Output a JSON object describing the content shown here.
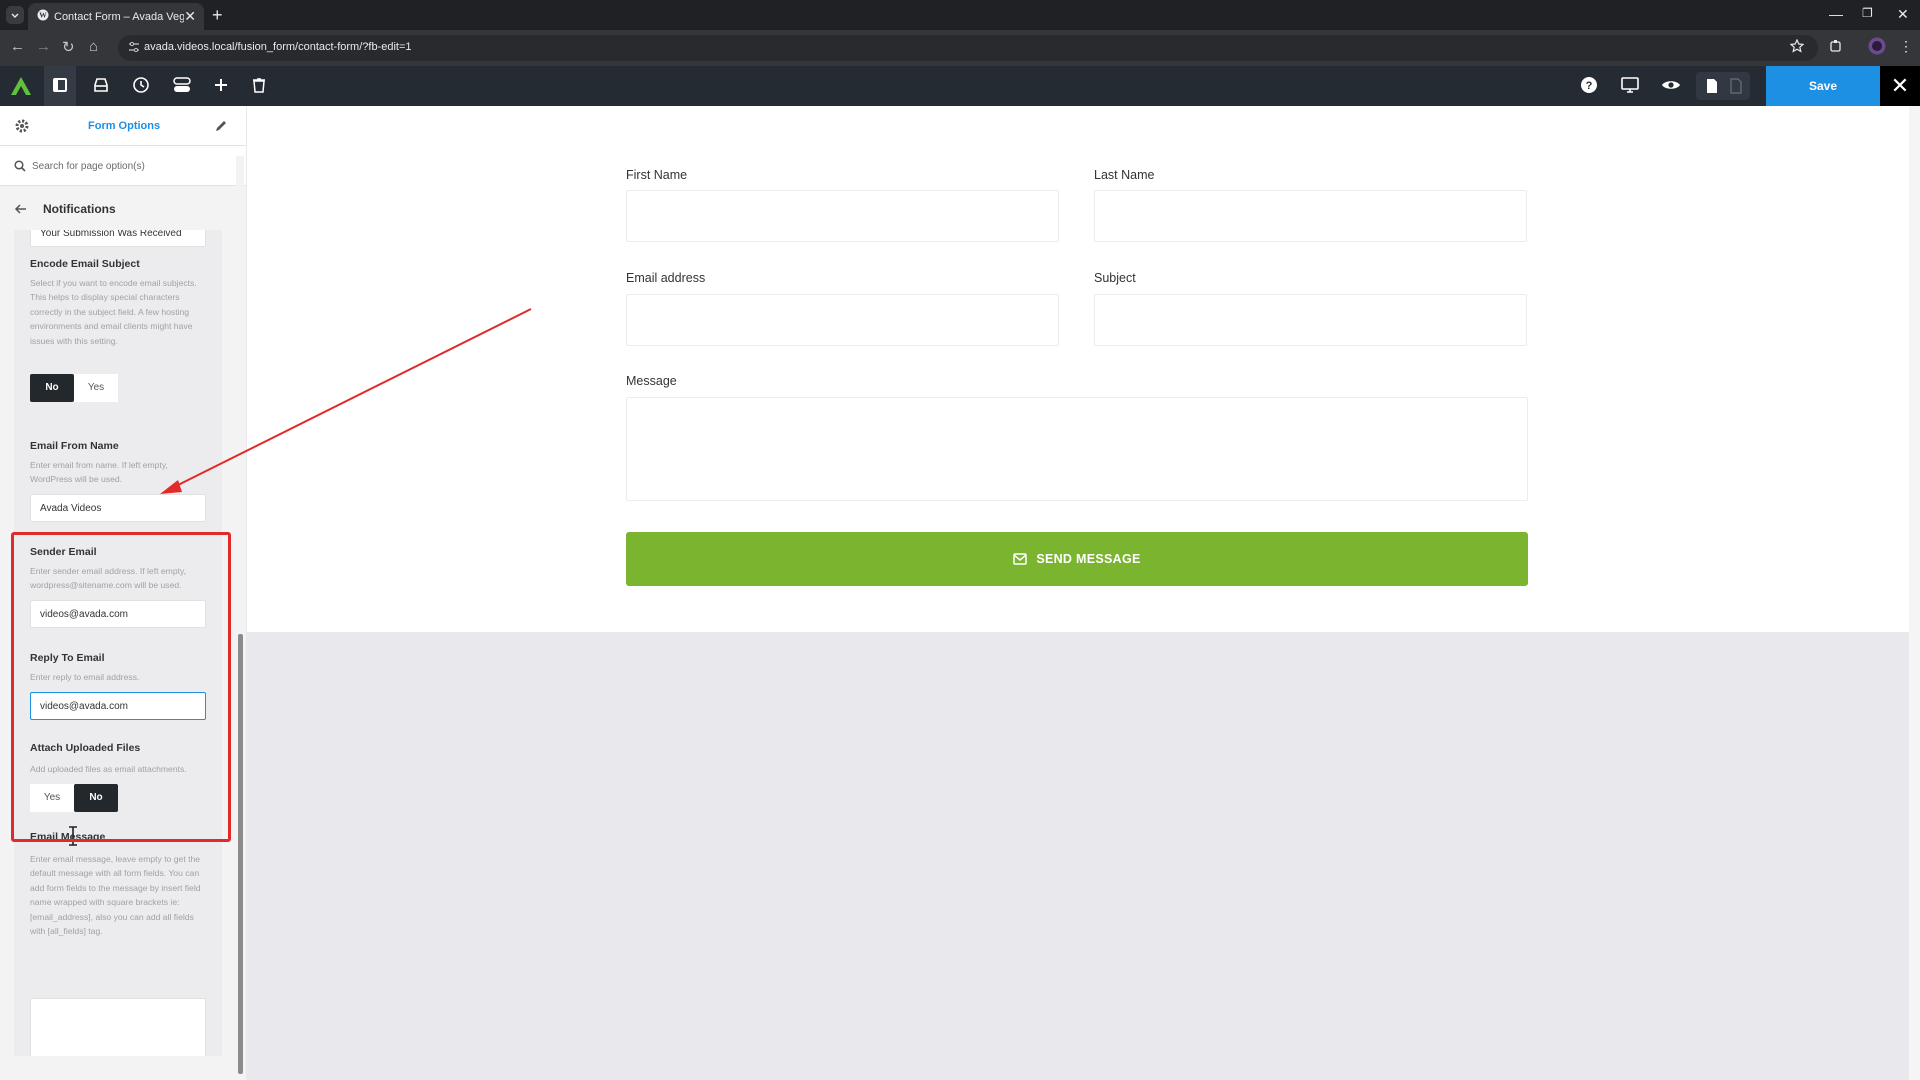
{
  "browser": {
    "tab_title": "Contact Form – Avada Vegan St",
    "url": "avada.videos.local/fusion_form/contact-form/?fb-edit=1"
  },
  "toolbar": {
    "save_label": "Save",
    "icons": [
      "avada-logo-icon",
      "sidebar-toggle-icon",
      "library-icon",
      "history-icon",
      "toggle-icon",
      "add-icon",
      "trash-icon",
      "help-icon",
      "desktop-icon",
      "preview-eye-icon",
      "page-icon",
      "page-outline-icon",
      "close-icon"
    ]
  },
  "sidebar": {
    "tab_label": "Form Options",
    "search_placeholder": "Search for page option(s)",
    "section_title": "Notifications",
    "subject_value": "Your Submission Was Received",
    "encode": {
      "label": "Encode Email Subject",
      "desc": "Select if you want to encode email subjects. This helps to display special characters correctly in the subject field. A few hosting environments and email clients might have issues with this setting.",
      "no": "No",
      "yes": "Yes",
      "selected": "No"
    },
    "from_name": {
      "label": "Email From Name",
      "desc": "Enter email from name. If left empty, WordPress will be used.",
      "value": "Avada Videos"
    },
    "sender": {
      "label": "Sender Email",
      "desc": "Enter sender email address. If left empty, wordpress@sitename.com will be used.",
      "value": "videos@avada.com"
    },
    "reply": {
      "label": "Reply To Email",
      "desc": "Enter reply to email address.",
      "value": "videos@avada.com"
    },
    "attach": {
      "label": "Attach Uploaded Files",
      "desc": "Add uploaded files as email attachments.",
      "yes": "Yes",
      "no": "No",
      "selected": "No"
    },
    "message": {
      "label": "Email Message",
      "desc": "Enter email message, leave empty to get the default message with all form fields. You can add form fields to the message by insert field name wrapped with square brackets ie: [email_address], also you can add all fields with [all_fields] tag.",
      "value": ""
    }
  },
  "form": {
    "first_name": "First Name",
    "last_name": "Last Name",
    "email": "Email address",
    "subject": "Subject",
    "message": "Message",
    "send_label": "SEND MESSAGE"
  },
  "colors": {
    "accent": "#1e90e4",
    "send_button": "#7bb42f",
    "highlight": "#e32a2a",
    "toolbar": "#252b33"
  }
}
